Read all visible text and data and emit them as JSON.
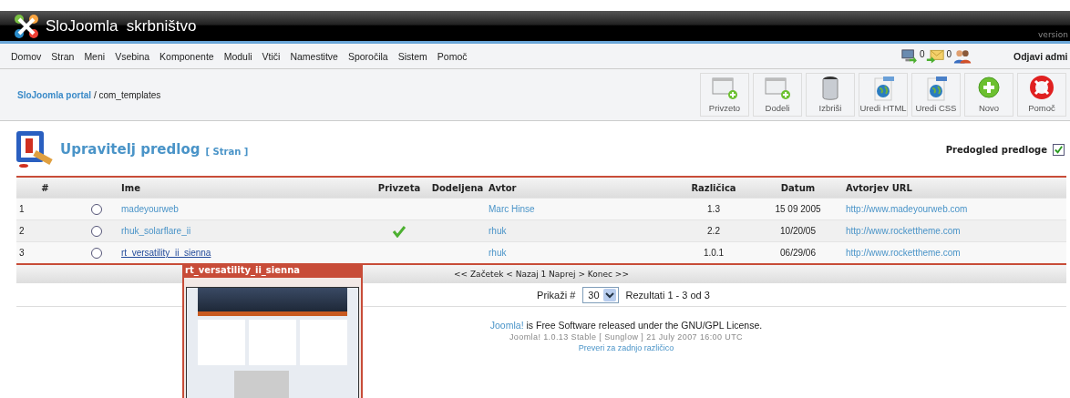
{
  "header": {
    "title": "SloJoomla  skrbništvo",
    "version": "version"
  },
  "menu": [
    "Domov",
    "Stran",
    "Meni",
    "Vsebina",
    "Komponente",
    "Moduli",
    "Vtiči",
    "Namestitve",
    "Sporočila",
    "Sistem",
    "Pomoč"
  ],
  "status": [
    {
      "kind": "computer"
    },
    {
      "kind": "messages",
      "count": "0"
    },
    {
      "kind": "users",
      "count": "0"
    }
  ],
  "logout": "Odjavi admi",
  "breadcrumb": {
    "link": "SloJoomla portal",
    "rest": "/ com_templates"
  },
  "toolbar": [
    {
      "kind": "window-add",
      "label": "Privzeto"
    },
    {
      "kind": "window-add",
      "label": "Dodeli"
    },
    {
      "kind": "trash",
      "label": "Izbriši"
    },
    {
      "kind": "globe-html",
      "label": "Uredi HTML"
    },
    {
      "kind": "globe-css",
      "label": "Uredi CSS"
    },
    {
      "kind": "plus",
      "label": "Novo"
    },
    {
      "kind": "lifebuoy",
      "label": "Pomoč"
    }
  ],
  "page_title": {
    "title": "Upravitelj predlog",
    "subtitle": "[ Stran ]"
  },
  "preview_toggle": {
    "label": "Predogled predloge",
    "checked": true
  },
  "table": {
    "columns": [
      "#",
      "Ime",
      "Privzeta",
      "Dodeljena",
      "Avtor",
      "Različica",
      "Datum",
      "Avtorjev URL"
    ],
    "rows": [
      {
        "num": "1",
        "selected": false,
        "name": "madeyourweb",
        "hovered": false,
        "default": false,
        "author": "Marc Hinse",
        "version": "1.3",
        "date": "15 09 2005",
        "url": "http://www.madeyourweb.com"
      },
      {
        "num": "2",
        "selected": false,
        "name": "rhuk_solarflare_ii",
        "hovered": false,
        "default": true,
        "author": "rhuk",
        "version": "2.2",
        "date": "10/20/05",
        "url": "http://www.rockettheme.com"
      },
      {
        "num": "3",
        "selected": false,
        "name": "rt_versatility_ii_sienna",
        "hovered": true,
        "default": false,
        "author": "rhuk",
        "version": "1.0.1",
        "date": "06/29/06",
        "url": "http://www.rockettheme.com"
      }
    ]
  },
  "pagination": "<< Začetek < Nazaj 1 Naprej > Konec >>",
  "limit": {
    "label": "Prikaži #",
    "value": "30",
    "results": "Rezultati 1 - 3 od 3"
  },
  "footer": {
    "link": "Joomla!",
    "text": "is Free Software released under the GNU/GPL License.",
    "version": "Joomla! 1.0.13 Stable [ Sunglow ] 21 July 2007 16:00 UTC",
    "check": "Preveri za zadnjo različico"
  },
  "tooltip": {
    "title": "rt_versatility_ii_sienna"
  }
}
